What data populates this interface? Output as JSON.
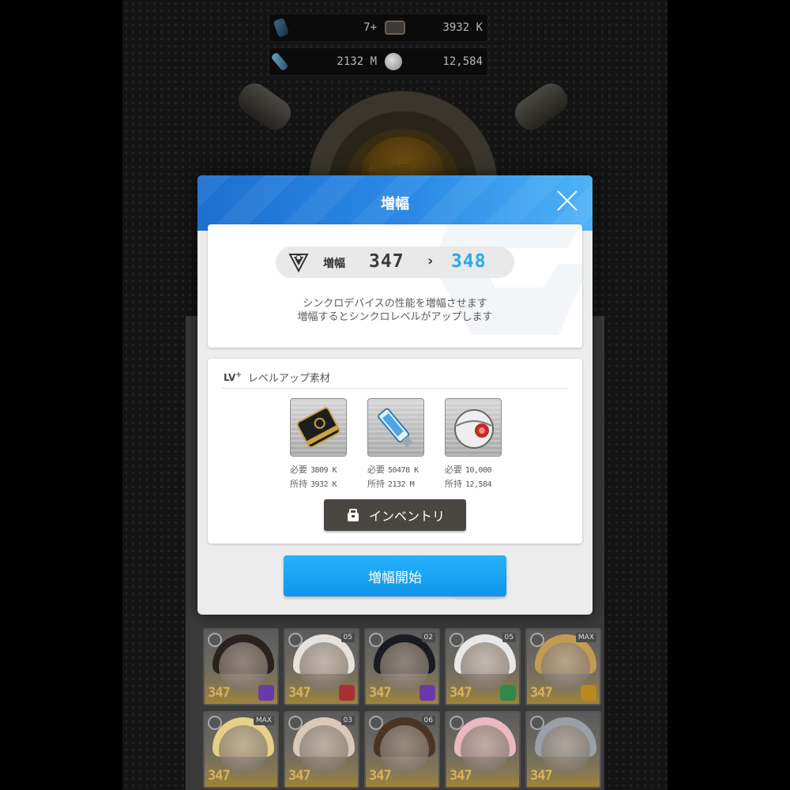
{
  "resources": {
    "row1": {
      "left_value": "7+",
      "right_value": "3932 K"
    },
    "row2": {
      "left_value": "2132 M",
      "right_value": "12,584"
    }
  },
  "background": {
    "device_label": "増幅",
    "roster_levels": [
      "347",
      "347",
      "347",
      "347",
      "347",
      "347",
      "347",
      "347",
      "347",
      "347"
    ],
    "roster_tags": [
      "",
      "05",
      "02",
      "05",
      "MAX",
      "MAX",
      "03",
      "06",
      "",
      ""
    ]
  },
  "modal": {
    "title": "増幅",
    "amplify": {
      "label": "増幅",
      "from": "347",
      "arrow": "›",
      "to": "348"
    },
    "description": [
      "シンクロデバイスの性能を増幅させます",
      "増幅するとシンクロレベルがアップします"
    ],
    "materials_section": {
      "badge": "LV",
      "badge_sup": "+",
      "title": "レベルアップ素材"
    },
    "materials": [
      {
        "icon": "black-card-icon",
        "required_label": "必要",
        "required": "3809 K",
        "owned_label": "所持",
        "owned": "3932 K"
      },
      {
        "icon": "usb-drive-icon",
        "required_label": "必要",
        "required": "50478 K",
        "owned_label": "所持",
        "owned": "2132 M"
      },
      {
        "icon": "robot-eye-orb-icon",
        "required_label": "必要",
        "required": "10,000",
        "owned_label": "所持",
        "owned": "12,584"
      }
    ],
    "inventory_label": "インベントリ",
    "start_label": "増幅開始"
  },
  "colors": {
    "header_start": "#1d6fd0",
    "header_end": "#4db3f6",
    "accent_blue": "#26a8ef",
    "button_dark": "#4a4642"
  }
}
